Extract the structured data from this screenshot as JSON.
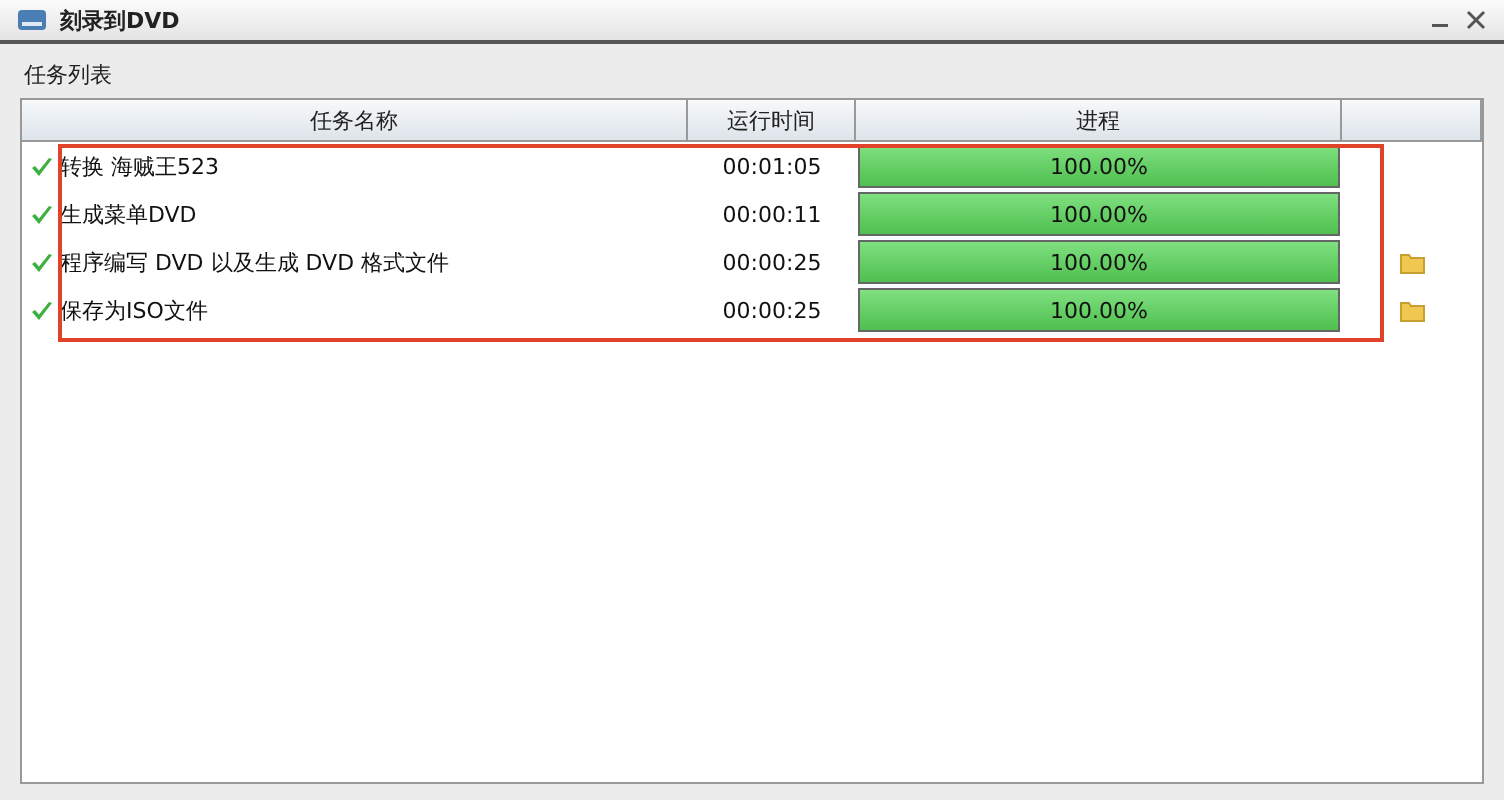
{
  "window": {
    "title": "刻录到DVD"
  },
  "section_label": "任务列表",
  "table": {
    "columns": [
      "任务名称",
      "运行时间",
      "进程"
    ],
    "rows": [
      {
        "done": true,
        "name": "转换 海贼王523",
        "time": "00:01:05",
        "level": 1,
        "reading": "100.00%",
        "folder": false
      },
      {
        "done": true,
        "name": "生成菜单DVD",
        "time": "00:00:11",
        "level": 1,
        "reading": "100.00%",
        "folder": false
      },
      {
        "done": true,
        "name": "程序编写 DVD 以及生成 DVD 格式文件",
        "time": "00:00:25",
        "level": 1,
        "reading": "100.00%",
        "folder": true
      },
      {
        "done": true,
        "name": "保存为ISO文件",
        "time": "00:00:25",
        "level": 1,
        "reading": "100.00%",
        "folder": true
      }
    ]
  }
}
